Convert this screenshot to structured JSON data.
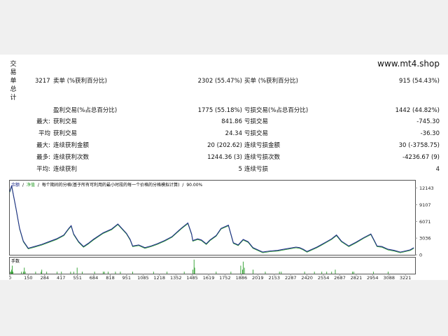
{
  "window": {
    "vertical_title": [
      "交",
      "易",
      "单",
      "总",
      "计"
    ],
    "site": "www.mt4.shop"
  },
  "stats": {
    "total_trades": "3217",
    "short_label": "卖单 (%获利百分比)",
    "short_value": "2302 (55.47%)",
    "long_label": "买单 (%获利百分比)",
    "long_value": "915 (54.43%)",
    "profit_label": "盈利交易(%占总百分比)",
    "profit_value": "1775 (55.18%)",
    "loss_label": "亏损交易(%占总百分比)",
    "loss_value": "1442 (44.82%)",
    "rows": [
      {
        "prefix": "最大:",
        "l_label": "获利交易",
        "l_value": "841.86",
        "r_label": "亏损交易",
        "r_value": "-745.30"
      },
      {
        "prefix": "平均",
        "l_label": "获利交易",
        "l_value": "24.34",
        "r_label": "亏损交易",
        "r_value": "-36.30"
      },
      {
        "prefix": "最大:",
        "l_label": "连续获利金额",
        "l_value": "20 (202.62)",
        "r_label": "连续亏损金额",
        "r_value": "30 (-3758.75)"
      },
      {
        "prefix": "最多:",
        "l_label": "连续获利次数",
        "l_value": "1244.36 (3)",
        "r_label": "连续亏损次数",
        "r_value": "-4236.67 (9)"
      },
      {
        "prefix": "平均:",
        "l_label": "连续获利",
        "l_value": "5",
        "r_label": "连续亏损",
        "r_value": "4"
      }
    ]
  },
  "chart": {
    "legend": [
      "余额",
      "净值",
      "每个期间的分格(基于所有可利用的最小时段的每一个价格的分格模拟计算)",
      "90.00%"
    ],
    "legend_sep": "/",
    "volume_label": "手数",
    "colors": {
      "balance": "#1f2d8a",
      "equity": "#2a9d2a",
      "volume": "#2a9d2a",
      "grid": "#888888"
    }
  },
  "chart_data": {
    "type": "line",
    "ylim": [
      0,
      13500
    ],
    "y_ticks": [
      0,
      3036,
      6071,
      9107,
      12143
    ],
    "y_tick_labels": [
      "0",
      "3036",
      "6071",
      "9107",
      "12143"
    ],
    "xlim": [
      0,
      3300
    ],
    "x_ticks": [
      0,
      150,
      284,
      417,
      551,
      684,
      818,
      951,
      1085,
      1218,
      1352,
      1485,
      1619,
      1752,
      1886,
      2019,
      2153,
      2287,
      2420,
      2554,
      2687,
      2821,
      2954,
      3088,
      3221
    ],
    "x_tick_labels": [
      "0",
      "150",
      "284",
      "417",
      "551",
      "684",
      "818",
      "951",
      "1085",
      "1218",
      "1352",
      "1485",
      "1619",
      "1752",
      "1886",
      "2019",
      "2153",
      "2287",
      "2420",
      "2554",
      "2687",
      "2821",
      "2954",
      "3088",
      "3221"
    ],
    "series": [
      {
        "key": "balance",
        "x": [
          0,
          15,
          30,
          50,
          80,
          110,
          150,
          200,
          260,
          320,
          380,
          440,
          480,
          500,
          520,
          560,
          600,
          640,
          680,
          760,
          830,
          880,
          950,
          980,
          1000,
          1050,
          1100,
          1150,
          1200,
          1260,
          1320,
          1400,
          1450,
          1480,
          1490,
          1530,
          1560,
          1600,
          1630,
          1680,
          1720,
          1780,
          1800,
          1820,
          1860,
          1900,
          1940,
          1980,
          2019,
          2060,
          2120,
          2180,
          2230,
          2280,
          2330,
          2360,
          2390,
          2420,
          2460,
          2500,
          2540,
          2580,
          2620,
          2660,
          2700,
          2760,
          2820,
          2880,
          2940,
          2970,
          2990,
          3030,
          3080,
          3130,
          3180,
          3221,
          3260,
          3290
        ],
        "y": [
          11500,
          12600,
          10800,
          8500,
          4800,
          2500,
          1200,
          1500,
          1900,
          2400,
          2900,
          3600,
          4800,
          5300,
          3800,
          2400,
          1500,
          2100,
          2800,
          4000,
          4700,
          5600,
          3900,
          2800,
          1600,
          1800,
          1300,
          1600,
          2000,
          2600,
          3300,
          4900,
          5800,
          3800,
          2600,
          2900,
          2700,
          2000,
          2700,
          3500,
          4800,
          5400,
          3800,
          2200,
          1800,
          2800,
          2400,
          1300,
          900,
          500,
          700,
          800,
          1000,
          1200,
          1400,
          1300,
          1000,
          600,
          1000,
          1400,
          1900,
          2400,
          2900,
          3600,
          2500,
          1600,
          2300,
          3100,
          3800,
          2500,
          1600,
          1500,
          1000,
          800,
          500,
          700,
          900,
          1300
        ]
      }
    ],
    "volume": {
      "x": [
        5,
        10,
        15,
        20,
        25,
        95,
        110,
        118,
        125,
        210,
        255,
        260,
        300,
        385,
        420,
        495,
        520,
        548,
        590,
        690,
        760,
        770,
        800,
        860,
        900,
        1000,
        1170,
        1280,
        1420,
        1490,
        1500,
        1505,
        1680,
        1800,
        1880,
        1895,
        1900,
        1910,
        1980,
        2080,
        2195,
        2210,
        2400,
        2480,
        2540,
        2580,
        2620,
        2650,
        2790,
        2800,
        2960,
        3080
      ],
      "y": [
        1,
        1,
        2,
        4,
        1,
        1,
        1,
        3,
        1,
        1,
        1,
        2,
        1,
        1,
        1,
        1,
        1,
        3,
        1,
        1,
        1,
        1,
        1,
        1,
        1,
        1,
        1,
        1,
        1,
        2,
        7,
        3,
        1,
        1,
        4,
        2,
        6,
        3,
        2,
        1,
        1,
        1,
        1,
        1,
        1,
        1,
        1,
        2,
        1,
        1,
        1,
        1
      ],
      "ylim": [
        0,
        8
      ]
    }
  }
}
